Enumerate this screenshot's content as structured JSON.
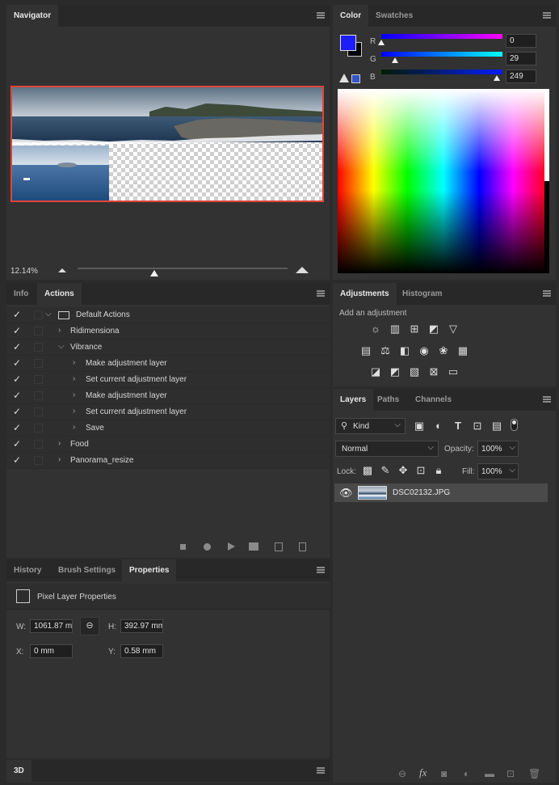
{
  "navigator": {
    "tab": "Navigator",
    "zoom": "12.14%"
  },
  "color": {
    "tabs": [
      "Color",
      "Swatches"
    ],
    "foreground": "#1d1df9",
    "channels": [
      {
        "label": "R",
        "value": "0"
      },
      {
        "label": "G",
        "value": "29"
      },
      {
        "label": "B",
        "value": "249"
      }
    ]
  },
  "info_actions": {
    "tabs": [
      "Info",
      "Actions"
    ],
    "rows": [
      {
        "checked": true,
        "expanded": true,
        "folder": true,
        "label": "Default Actions",
        "level": 0
      },
      {
        "checked": true,
        "expanded": false,
        "label": "Ridimensiona",
        "level": 1
      },
      {
        "checked": true,
        "expanded": true,
        "label": "Vibrance",
        "level": 1
      },
      {
        "checked": true,
        "expanded": false,
        "label": "Make adjustment layer",
        "level": 2
      },
      {
        "checked": true,
        "expanded": false,
        "label": "Set current adjustment layer",
        "level": 2
      },
      {
        "checked": true,
        "expanded": false,
        "label": "Make adjustment layer",
        "level": 2
      },
      {
        "checked": true,
        "expanded": false,
        "label": "Set current adjustment layer",
        "level": 2
      },
      {
        "checked": true,
        "expanded": false,
        "label": "Save",
        "level": 2
      },
      {
        "checked": true,
        "expanded": false,
        "label": "Food",
        "level": 1
      },
      {
        "checked": true,
        "expanded": false,
        "label": "Panorama_resize",
        "level": 1
      }
    ]
  },
  "adjustments": {
    "tabs": [
      "Adjustments",
      "Histogram"
    ],
    "hint": "Add an adjustment"
  },
  "layers": {
    "tabs": [
      "Layers",
      "Paths",
      "Channels"
    ],
    "filter": "Kind",
    "blend_mode": "Normal",
    "opacity_label": "Opacity:",
    "opacity": "100%",
    "lock_label": "Lock:",
    "fill_label": "Fill:",
    "fill": "100%",
    "layer_name": "DSC02132.JPG"
  },
  "properties": {
    "tabs": [
      "History",
      "Brush Settings",
      "Properties"
    ],
    "title": "Pixel Layer Properties",
    "w_label": "W:",
    "w": "1061.87 mm",
    "h_label": "H:",
    "h": "392.97 mm",
    "x_label": "X:",
    "x": "0 mm",
    "y_label": "Y:",
    "y": "0.58 mm"
  },
  "threed": {
    "tab": "3D"
  }
}
